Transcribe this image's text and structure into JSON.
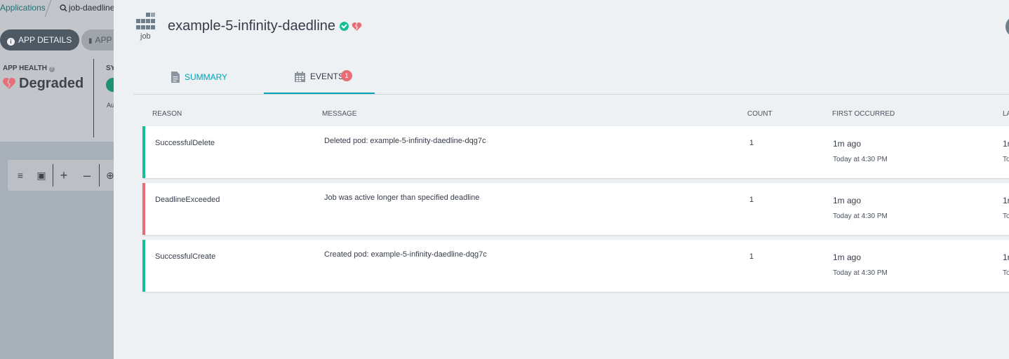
{
  "background": {
    "breadcrumb": {
      "applications": "Applications",
      "search_text": "job-daedline"
    },
    "buttons": {
      "app_details": "APP DETAILS",
      "app_second": "APP"
    },
    "health": {
      "label": "APP HEALTH",
      "value": "Degraded"
    },
    "sync": {
      "label_partial": "SY",
      "sub_partial": "Au"
    }
  },
  "panel": {
    "kind": "job",
    "title": "example-5-infinity-daedline",
    "status_colors": {
      "healthy": "#18be94",
      "degraded": "#e96d76"
    },
    "tabs": [
      {
        "label": "SUMMARY",
        "icon": "file-icon",
        "active": false
      },
      {
        "label": "EVENTS",
        "icon": "calendar-icon",
        "active": true,
        "badge": "1"
      }
    ],
    "events": {
      "columns": [
        "REASON",
        "MESSAGE",
        "COUNT",
        "FIRST OCCURRED",
        "LA"
      ],
      "rows": [
        {
          "type": "normal",
          "reason": "SuccessfulDelete",
          "message": "Deleted pod: example-5-infinity-daedline-dqg7c",
          "count": "1",
          "first": "1m ago",
          "first_sub": "Today at 4:30 PM",
          "last": "1r",
          "last_sub": "To"
        },
        {
          "type": "warning",
          "reason": "DeadlineExceeded",
          "message": "Job was active longer than specified deadline",
          "count": "1",
          "first": "1m ago",
          "first_sub": "Today at 4:30 PM",
          "last": "1r",
          "last_sub": "To"
        },
        {
          "type": "normal",
          "reason": "SuccessfulCreate",
          "message": "Created pod: example-5-infinity-daedline-dqg7c",
          "count": "1",
          "first": "1m ago",
          "first_sub": "Today at 4:30 PM",
          "last": "1r",
          "last_sub": "To"
        }
      ]
    }
  }
}
